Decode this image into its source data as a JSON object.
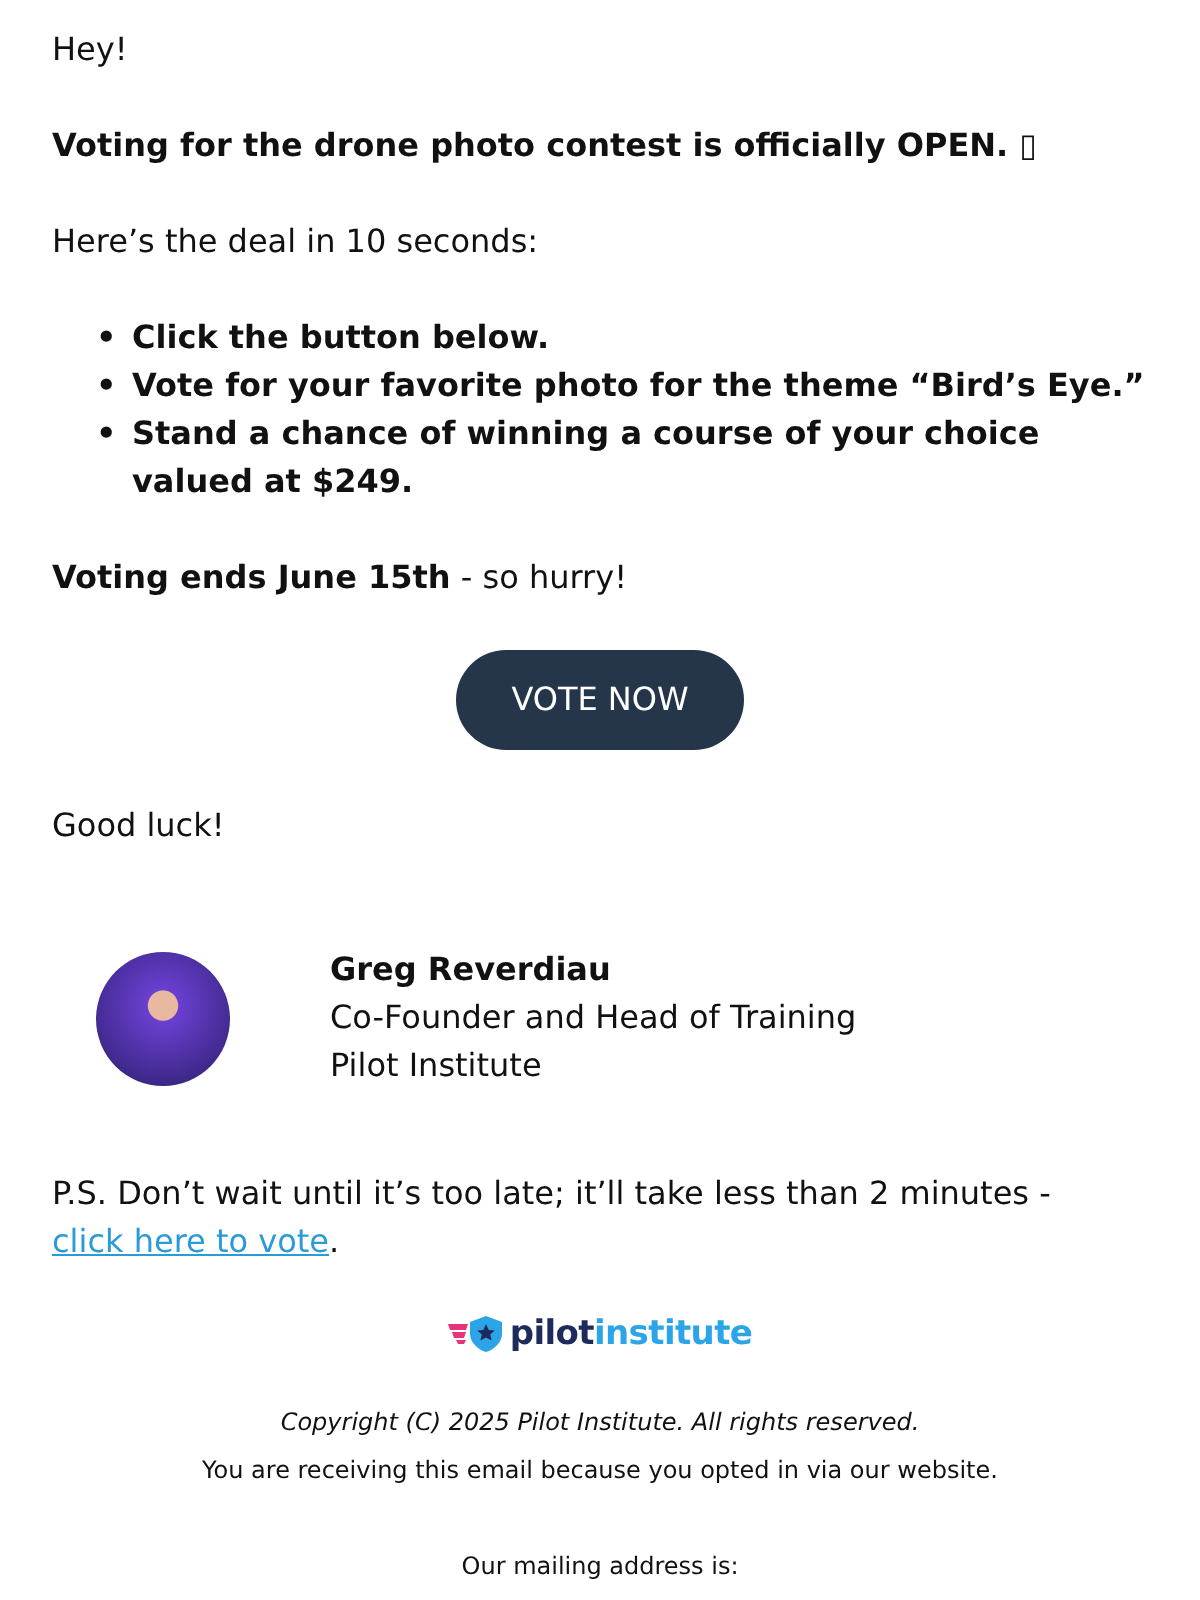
{
  "greeting": "Hey!",
  "headline": "Voting for the drone photo contest is officially OPEN. ▯",
  "intro": "Here’s the deal in 10 seconds:",
  "steps": [
    {
      "marker": "•",
      "text": "Click the button below."
    },
    {
      "marker": "•",
      "text": "Vote for your favorite photo for the theme “Bird’s Eye.”"
    },
    {
      "marker": "•",
      "text": "Stand a chance of winning a course of your choice valued at $249."
    }
  ],
  "deadline": {
    "bold": "Voting ends June 15th",
    "rest": " - so hurry!"
  },
  "button": "VOTE NOW",
  "sign_off": "Good luck!",
  "signature": {
    "name": "Greg Reverdiau",
    "role": "Co-Founder and Head of Training",
    "company": "Pilot Institute"
  },
  "postscript": {
    "text": "P.S. Don’t wait until it’s too late; it’ll take less than 2 minutes - ",
    "link": "click here to vote",
    "end": "."
  },
  "logo": {
    "part_1": "pilot",
    "part_2": "institute"
  },
  "footer": {
    "copyright": "Copyright (C) 2025 Pilot Institute. All rights reserved.",
    "notice": "You are receiving this email because you opted in via our website.",
    "address_heading": "Our mailing address is:"
  }
}
